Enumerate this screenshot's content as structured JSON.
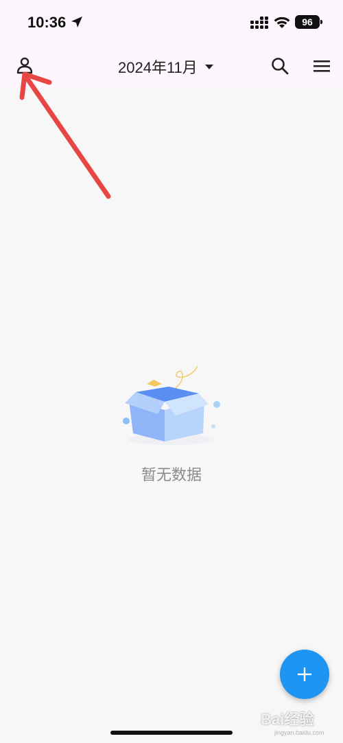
{
  "status_bar": {
    "time": "10:36",
    "battery": "96",
    "icons": [
      "location-arrow-icon",
      "signal-icon",
      "wifi-icon",
      "battery-icon"
    ]
  },
  "header": {
    "month_label": "2024年11月",
    "icons": [
      "user-icon",
      "caret-down-icon",
      "search-icon",
      "menu-icon"
    ]
  },
  "empty_state": {
    "text": "暂无数据",
    "icon": "empty-box-icon"
  },
  "fab": {
    "icon": "plus-icon",
    "color": "#1e94f3"
  },
  "annotation": {
    "icon": "red-arrow-icon",
    "color": "#e84545"
  },
  "watermark": {
    "brand": "Bai经验",
    "sub": "jingyan.baidu.com"
  },
  "colors": {
    "header_bg": "#fdf6fd",
    "page_bg": "#f7f7f7",
    "accent": "#1e94f3"
  }
}
